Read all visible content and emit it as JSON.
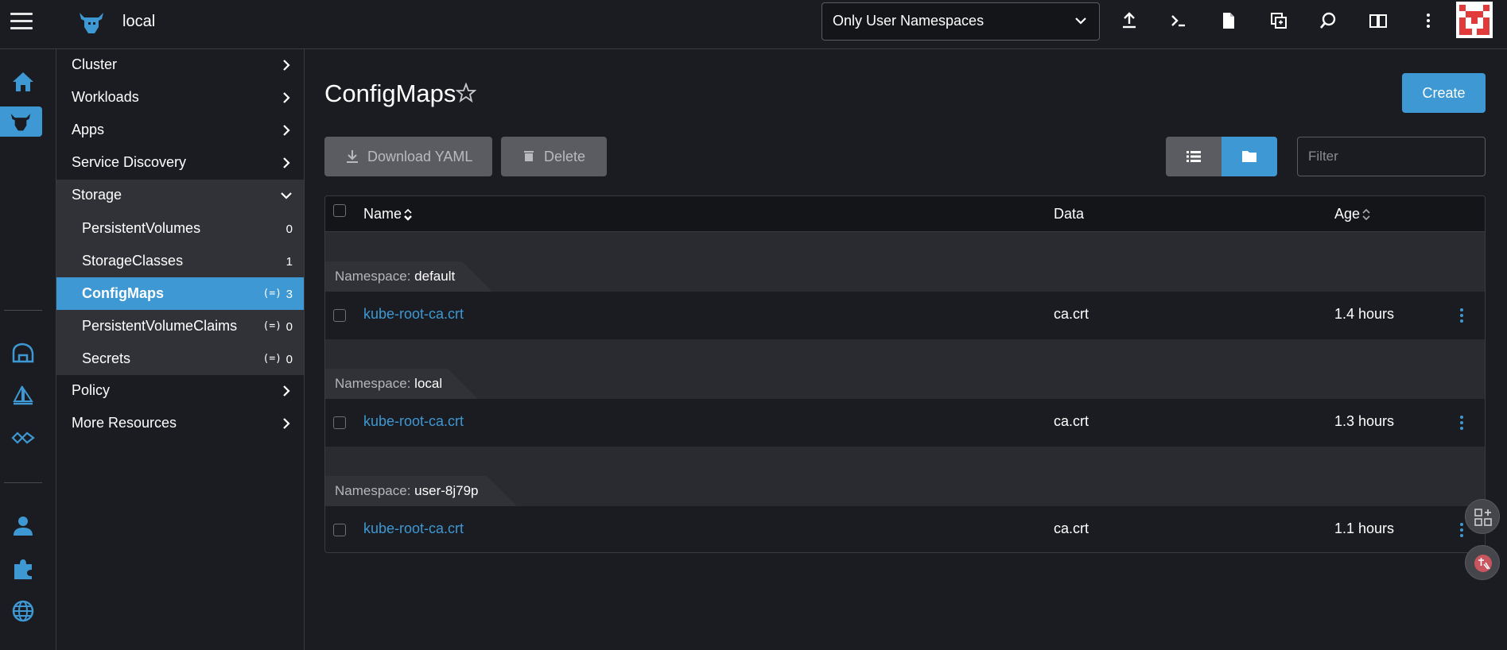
{
  "header": {
    "cluster_name": "local",
    "namespace_filter": "Only User Namespaces"
  },
  "sidenav": {
    "groups": [
      {
        "label": "Cluster"
      },
      {
        "label": "Workloads"
      },
      {
        "label": "Apps"
      },
      {
        "label": "Service Discovery"
      },
      {
        "label": "Storage"
      },
      {
        "label": "Policy"
      },
      {
        "label": "More Resources"
      }
    ],
    "storage_items": [
      {
        "label": "PersistentVolumes",
        "count": "0"
      },
      {
        "label": "StorageClasses",
        "count": "1"
      },
      {
        "label": "ConfigMaps",
        "count": "3"
      },
      {
        "label": "PersistentVolumeClaims",
        "count": "0"
      },
      {
        "label": "Secrets",
        "count": "0"
      }
    ],
    "namespaced_glyph": "(=)"
  },
  "main": {
    "title": "ConfigMaps",
    "create_label": "Create",
    "download_label": "Download YAML",
    "delete_label": "Delete",
    "filter_placeholder": "Filter"
  },
  "table": {
    "columns": {
      "name": "Name",
      "data": "Data",
      "age": "Age"
    },
    "namespace_key": "Namespace:",
    "groups": [
      {
        "namespace": "default",
        "row": {
          "name": "kube-root-ca.crt",
          "data": "ca.crt",
          "age": "1.4 hours"
        }
      },
      {
        "namespace": "local",
        "row": {
          "name": "kube-root-ca.crt",
          "data": "ca.crt",
          "age": "1.3 hours"
        }
      },
      {
        "namespace": "user-8j79p",
        "row": {
          "name": "kube-root-ca.crt",
          "data": "ca.crt",
          "age": "1.1 hours"
        }
      }
    ]
  },
  "colors": {
    "accent": "#3d98d3",
    "background": "#1b1c21",
    "panel": "#313237"
  }
}
